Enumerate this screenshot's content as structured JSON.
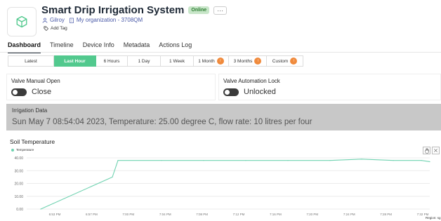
{
  "header": {
    "title": "Smart Drip Irrigation System",
    "status_badge": "Online",
    "more_label": "···",
    "owner": "Gilroy",
    "organization": "My organization - 3708QM",
    "add_tag": "Add Tag"
  },
  "tabs": [
    {
      "label": "Dashboard",
      "active": true
    },
    {
      "label": "Timeline",
      "active": false
    },
    {
      "label": "Device Info",
      "active": false
    },
    {
      "label": "Metadata",
      "active": false
    },
    {
      "label": "Actions Log",
      "active": false
    }
  ],
  "time_ranges": [
    {
      "label": "Latest",
      "active": false,
      "locked": false
    },
    {
      "label": "Last Hour",
      "active": true,
      "locked": false
    },
    {
      "label": "6 Hours",
      "active": false,
      "locked": false
    },
    {
      "label": "1 Day",
      "active": false,
      "locked": false
    },
    {
      "label": "1 Week",
      "active": false,
      "locked": false
    },
    {
      "label": "1 Month",
      "active": false,
      "locked": true
    },
    {
      "label": "3 Months",
      "active": false,
      "locked": true
    },
    {
      "label": "Custom",
      "active": false,
      "locked": true
    }
  ],
  "widgets": {
    "valve_manual": {
      "title": "Valve Manual Open",
      "state": "Close"
    },
    "valve_lock": {
      "title": "Valve Automation Lock",
      "state": "Unlocked"
    },
    "irrigation": {
      "title": "Irrigation Data",
      "text": "Sun May 7 08:54:04 2023, Temperature: 25.00 degree C, flow rate: 10 litres per four"
    }
  },
  "chart_widget": {
    "title": "Soil Temperature",
    "region_label": "Region: sg"
  },
  "colors": {
    "accent": "#52c98e",
    "series": "#6fd2b0",
    "lock_badge": "#f08a3c",
    "online_badge_bg": "#c8e6c9"
  },
  "chart_data": {
    "type": "line",
    "series": [
      {
        "name": "Temperature",
        "x": [
          "6:53 PM",
          "6:57 PM",
          "7:00 PM",
          "7:04 PM",
          "7:10 PM",
          "7:14 PM",
          "7:18 PM",
          "7:22 PM",
          "7:26 PM",
          "7:31 PM",
          "7:35 PM",
          "7:36 PM"
        ],
        "values": [
          0,
          25,
          38,
          38,
          38,
          38,
          38,
          38,
          39,
          38,
          38,
          37
        ]
      }
    ],
    "x_ticks": [
      "6:53 PM",
      "6:57 PM",
      "7:00 PM",
      "7:04 PM",
      "7:08 PM",
      "7:12 PM",
      "7:16 PM",
      "7:20 PM",
      "7:24 PM",
      "7:28 PM",
      "7:32 PM"
    ],
    "y_ticks": [
      "0.00",
      "10.00",
      "20.00",
      "30.00",
      "40.00"
    ],
    "ylim": [
      0,
      40
    ],
    "grid": true,
    "legend": "top-left",
    "title": "Soil Temperature",
    "xlabel": "",
    "ylabel": ""
  }
}
